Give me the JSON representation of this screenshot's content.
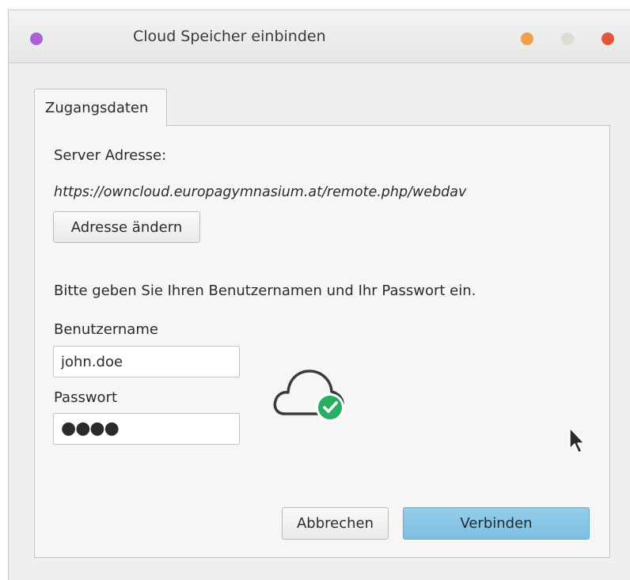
{
  "window": {
    "title": "Cloud Speicher einbinden",
    "controls": {
      "menu_color": "#a963d4",
      "minimize_color": "#f0a048",
      "maximize_color": "#d8dfd2",
      "close_color": "#e2553b"
    }
  },
  "tabs": [
    {
      "label": "Zugangsdaten",
      "active": true
    }
  ],
  "server": {
    "label": "Server Adresse:",
    "url": "https://owncloud.europagymnasium.at/remote.php/webdav",
    "change_button": "Adresse ändern"
  },
  "credentials": {
    "instruction": "Bitte geben Sie Ihren Benutzernamen und Ihr Passwort ein.",
    "username_label": "Benutzername",
    "username_value": "john.doe",
    "password_label": "Passwort",
    "password_value": "●●●●"
  },
  "status_icon": {
    "name": "cloud-check-icon",
    "accent": "#27ae60"
  },
  "actions": {
    "cancel": "Abbrechen",
    "connect": "Verbinden",
    "primary_color": "#8ac6e7"
  }
}
